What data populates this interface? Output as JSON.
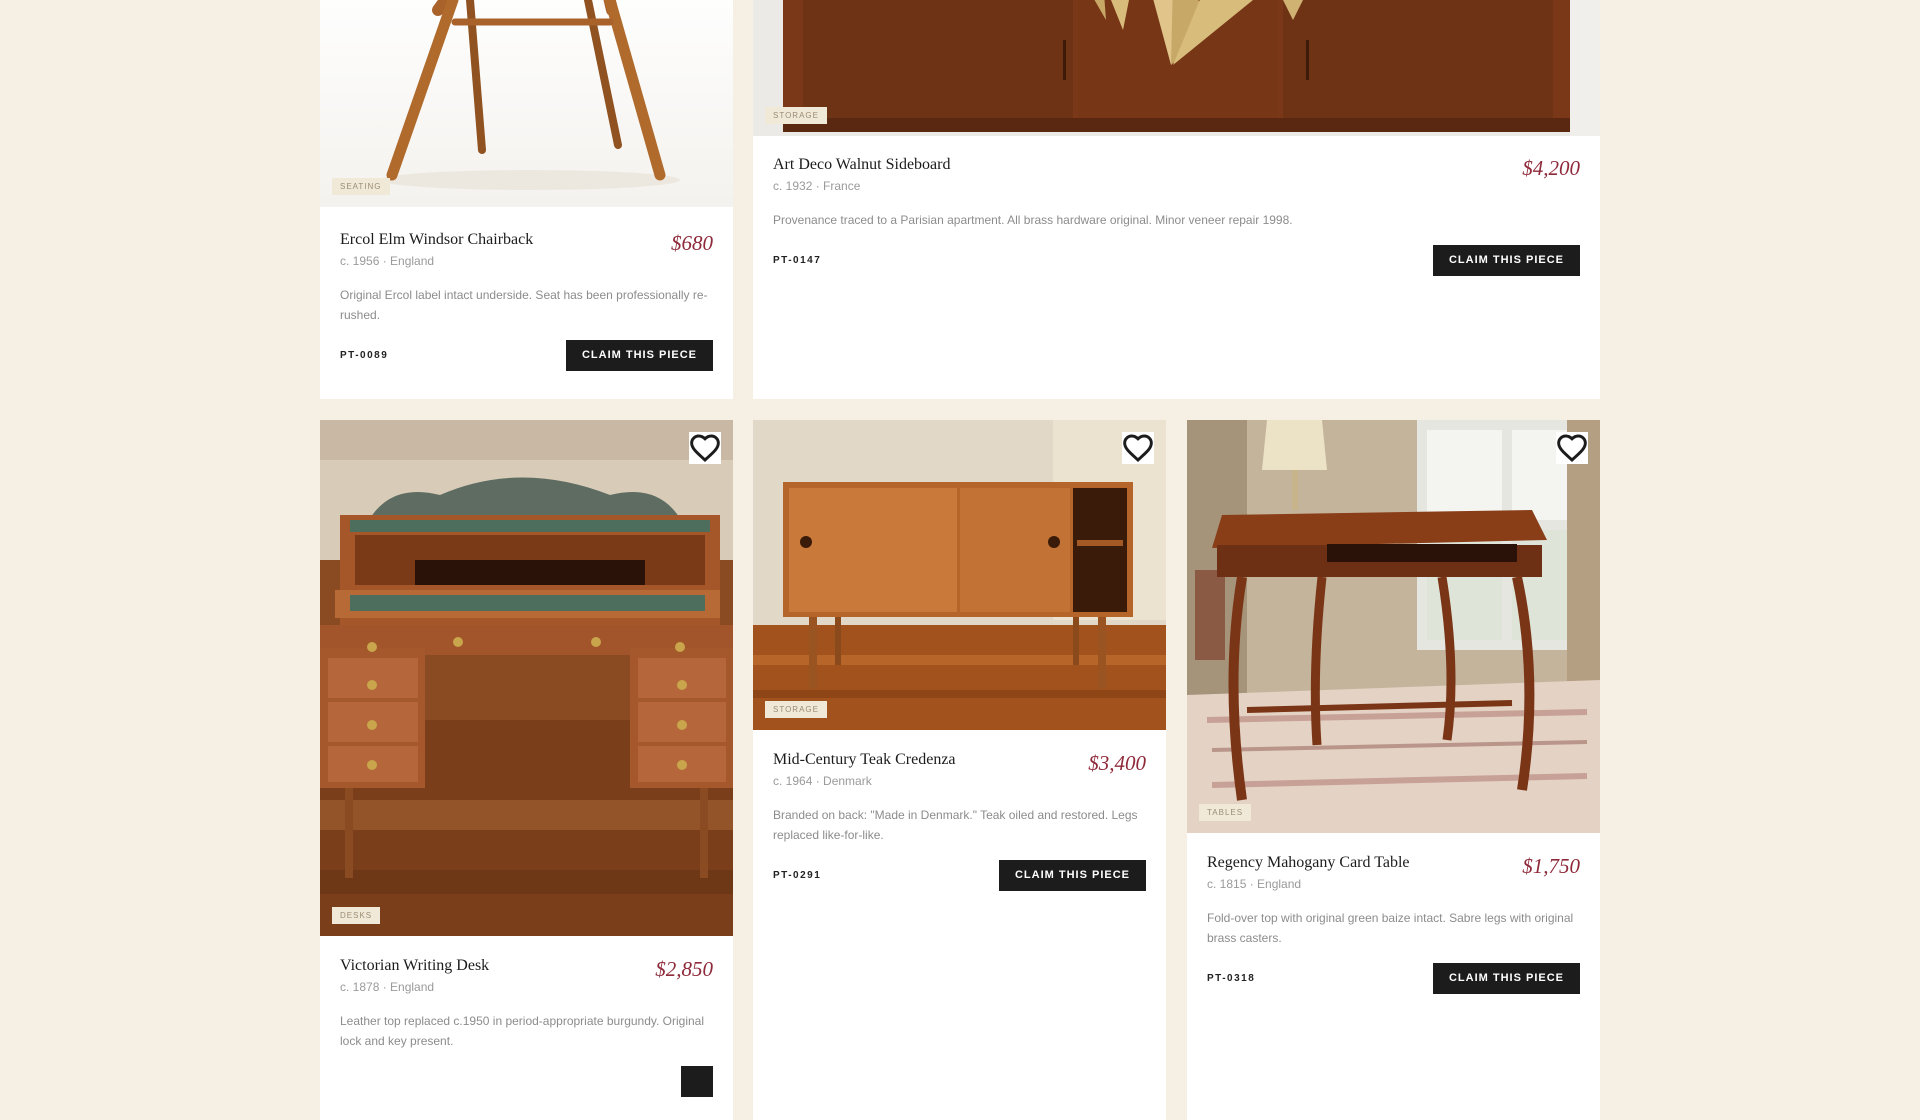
{
  "colors": {
    "page_background": "#f5efe4",
    "card_background": "#ffffff",
    "price": "#8e2a3a",
    "button": "#1c1c1c",
    "badge_background": "#f1e9d8"
  },
  "icons": {
    "favorite": "heart-outline-icon"
  },
  "cards": [
    {
      "category": "SEATING",
      "title": "Ercol Elm Windsor Chairback",
      "meta": "c. 1956 · England",
      "price": "$680",
      "description": "Original Ercol label intact underside. Seat has been professionally re-rushed.",
      "sku": "PT-0089",
      "cta": "CLAIM THIS PIECE"
    },
    {
      "category": "STORAGE",
      "title": "Art Deco Walnut Sideboard",
      "meta": "c. 1932 · France",
      "price": "$4,200",
      "description": "Provenance traced to a Parisian apartment. All brass hardware original. Minor veneer repair 1998.",
      "sku": "PT-0147",
      "cta": "CLAIM THIS PIECE"
    },
    {
      "category": "DESKS",
      "title": "Victorian Writing Desk",
      "meta": "c. 1878 · England",
      "price": "$2,850",
      "description": "Leather top replaced c.1950 in period-appropriate burgundy. Original lock and key present.",
      "sku": "",
      "cta": ""
    },
    {
      "category": "STORAGE",
      "title": "Mid-Century Teak Credenza",
      "meta": "c. 1964 · Denmark",
      "price": "$3,400",
      "description": "Branded on back: \"Made in Denmark.\" Teak oiled and restored. Legs replaced like-for-like.",
      "sku": "PT-0291",
      "cta": "CLAIM THIS PIECE"
    },
    {
      "category": "TABLES",
      "title": "Regency Mahogany Card Table",
      "meta": "c. 1815 · England",
      "price": "$1,750",
      "description": "Fold-over top with original green baize intact. Sabre legs with original brass casters.",
      "sku": "PT-0318",
      "cta": "CLAIM THIS PIECE"
    }
  ]
}
